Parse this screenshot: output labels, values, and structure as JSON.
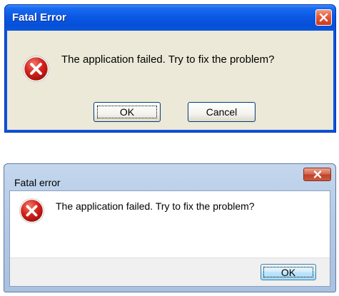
{
  "dialogs": [
    {
      "style": "xp",
      "title": "Fatal Error",
      "message": "The application failed. Try to fix the problem?",
      "icon": "error-icon",
      "buttons": {
        "ok": "OK",
        "cancel": "Cancel"
      },
      "colors": {
        "titlebar": "#0a54e0",
        "body": "#ece9d8",
        "close": "#e2583a"
      }
    },
    {
      "style": "win7-basic",
      "title": "Fatal error",
      "message": "The application failed. Try to fix the problem?",
      "icon": "error-icon",
      "buttons": {
        "ok": "OK"
      },
      "colors": {
        "frame": "#b5cbe6",
        "footer": "#f0f0f0",
        "close": "#c0412a"
      }
    }
  ]
}
